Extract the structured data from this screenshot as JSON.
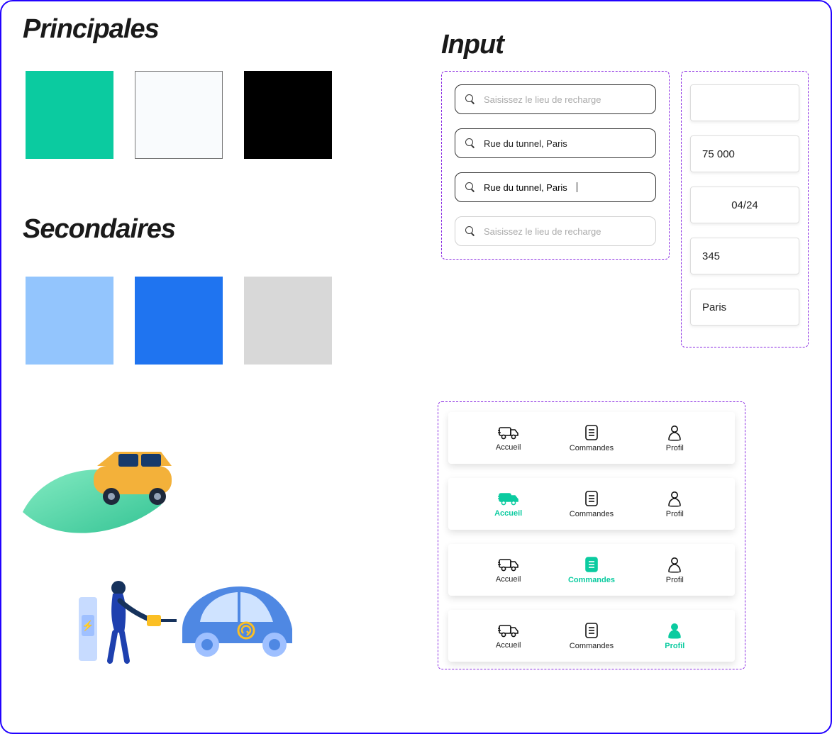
{
  "headings": {
    "principales": "Principales",
    "secondaires": "Secondaires",
    "input": "Input"
  },
  "palette": {
    "primary": [
      {
        "hex": "#0bcba0"
      },
      {
        "hex": "#f9fbfd",
        "bordered": true
      },
      {
        "hex": "#000000"
      }
    ],
    "secondary": [
      {
        "hex": "#93c5fd"
      },
      {
        "hex": "#1f74f0"
      },
      {
        "hex": "#d8d8d8"
      }
    ]
  },
  "search_inputs": [
    {
      "placeholder": "Saisissez le lieu de recharge",
      "value": "",
      "variant": "dark"
    },
    {
      "placeholder": "",
      "value": "Rue du tunnel, Paris",
      "variant": "dark"
    },
    {
      "placeholder": "",
      "value": "Rue du tunnel, Paris",
      "variant": "dark",
      "has_cursor": true
    },
    {
      "placeholder": "Saisissez le lieu de recharge",
      "value": "",
      "variant": "light"
    }
  ],
  "small_inputs": [
    {
      "value": "",
      "align": "left"
    },
    {
      "value": "75 000",
      "align": "left"
    },
    {
      "value": "04/24",
      "align": "center"
    },
    {
      "value": "345",
      "align": "left"
    },
    {
      "value": "Paris",
      "align": "left"
    }
  ],
  "nav": {
    "items": [
      {
        "key": "accueil",
        "label": "Accueil",
        "icon": "truck-icon"
      },
      {
        "key": "commandes",
        "label": "Commandes",
        "icon": "document-icon"
      },
      {
        "key": "profil",
        "label": "Profil",
        "icon": "person-icon"
      }
    ],
    "variants": [
      {
        "active": null
      },
      {
        "active": "accueil"
      },
      {
        "active": "commandes"
      },
      {
        "active": "profil"
      }
    ]
  }
}
